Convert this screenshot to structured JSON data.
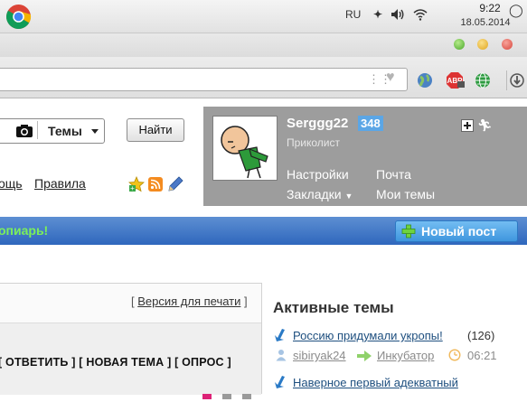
{
  "os": {
    "language": "RU",
    "time": "9:22",
    "date": "18.05.2014"
  },
  "search": {
    "category": "Темы",
    "button": "Найти"
  },
  "nav_links": {
    "help_fragment": "ощь",
    "rules": "Правила"
  },
  "user": {
    "name": "Serggg22",
    "rating": "348",
    "rank": "Приколист",
    "links": {
      "settings": "Настройки",
      "mail": "Почта",
      "bookmarks": "Закладки",
      "my_topics": "Мои темы"
    }
  },
  "promo": {
    "text": "опиарь!",
    "new_post": "Новый пост"
  },
  "post_tools": {
    "print_version": "Версия для печати",
    "actions": "[ ОТВЕТИТЬ ] [ НОВАЯ ТЕМА ] [ ОПРОС ]"
  },
  "active_topics": {
    "title": "Активные темы",
    "items": [
      {
        "title": "Россию придумали укропы!",
        "count": "(126)",
        "author": "sibiryak24",
        "section": "Инкубатор",
        "time": "06:21"
      },
      {
        "title": "Наверное первый адекватный"
      }
    ]
  }
}
